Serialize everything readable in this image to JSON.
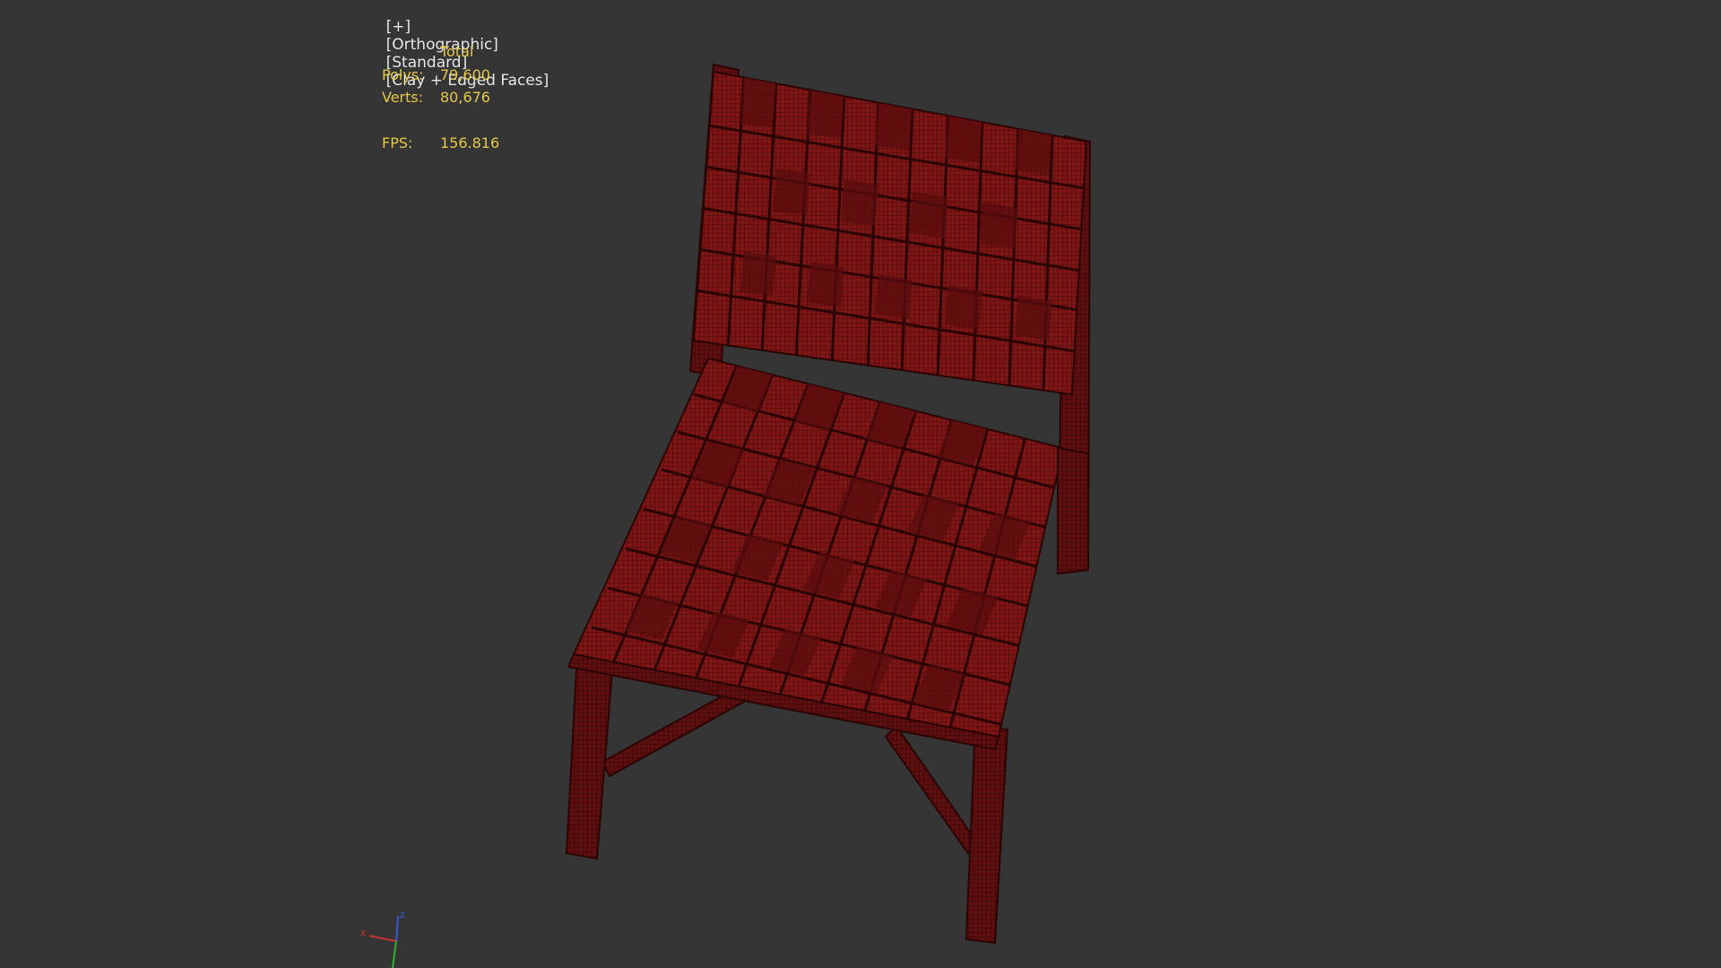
{
  "viewport": {
    "label_plus": "[+]",
    "label_view": "[Orthographic]",
    "label_shading": "[Standard]",
    "label_style": "[Clay + Edged Faces]"
  },
  "stats": {
    "header": "Total",
    "polys_label": "Polys:",
    "polys_value": "79,600",
    "verts_label": "Verts:",
    "verts_value": "80,676",
    "fps_label": "FPS:",
    "fps_value": "156.816"
  },
  "gizmo": {
    "z_label": "z",
    "x_label": "x",
    "y_label": "y"
  },
  "colors": {
    "background": "#353535",
    "stats_text": "#e6c84a",
    "label_text": "#e6e6e6",
    "model_fill": "#7a1414",
    "model_edge": "#3a0606"
  },
  "model": {
    "icon": "woven-chair-mesh"
  }
}
